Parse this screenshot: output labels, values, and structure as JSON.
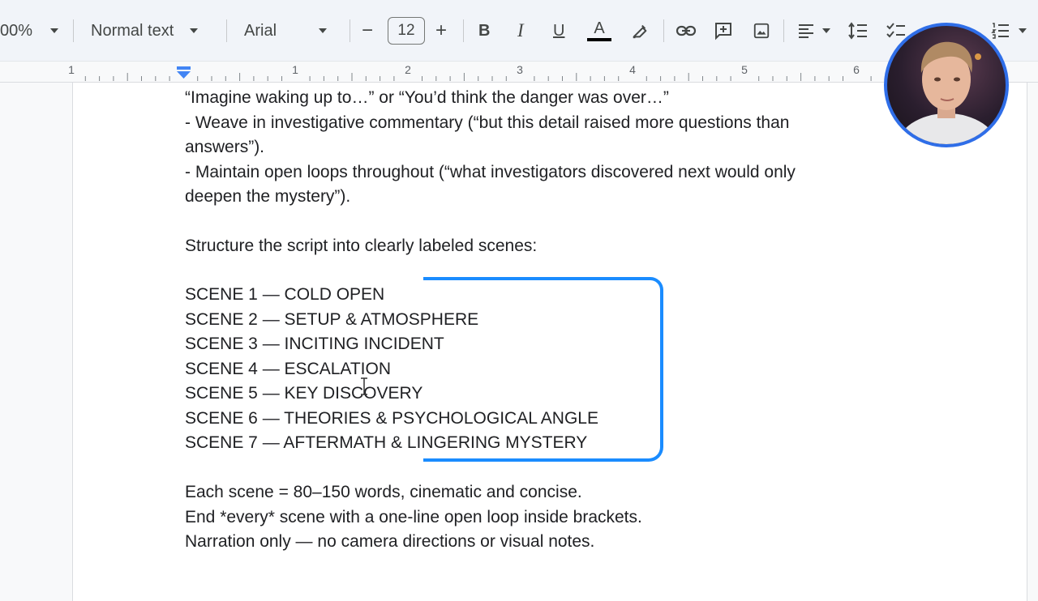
{
  "toolbar": {
    "zoom": "00%",
    "style": "Normal text",
    "font": "Arial",
    "font_size": "12",
    "decrease_size": "−",
    "increase_size": "+",
    "bold": "B",
    "italic": "I",
    "underline": "U",
    "text_color": "A"
  },
  "ruler": {
    "numbers": [
      "1",
      "1",
      "2",
      "3",
      "4",
      "5",
      "6"
    ]
  },
  "document": {
    "lines": [
      "  “Imagine waking up to…” or “You’d think the danger was over…”",
      "- Weave in investigative commentary (“but this detail raised more questions than",
      "answers”).",
      "- Maintain open loops throughout (“what investigators discovered next would only",
      "deepen the mystery”).",
      "Structure the script into clearly labeled scenes:",
      "SCENE 1 — COLD OPEN",
      "SCENE 2 — SETUP & ATMOSPHERE",
      "SCENE 3 — INCITING INCIDENT",
      "SCENE 4 — ESCALATION",
      "SCENE 5 — KEY DISCOVERY",
      "SCENE 6 — THEORIES & PSYCHOLOGICAL ANGLE",
      "SCENE 7 — AFTERMATH & LINGERING MYSTERY",
      "Each scene = 80–150 words, cinematic and concise.",
      "End *every* scene with a one-line open loop inside brackets.",
      "Narration only — no camera directions or visual notes."
    ]
  },
  "colors": {
    "bracket": "#1a8cff",
    "webcam_border": "#2f6ee8"
  }
}
